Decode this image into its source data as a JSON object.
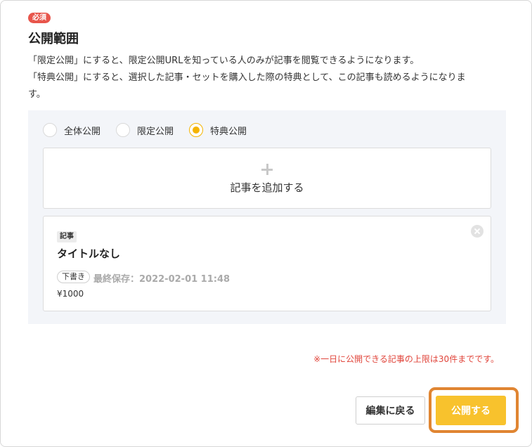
{
  "section": {
    "required_label": "必須",
    "title": "公開範囲",
    "description_line1": "「限定公開」にすると、限定公開URLを知っている人のみが記事を閲覧できるようになります。",
    "description_line2": "「特典公開」にすると、選択した記事・セットを購入した際の特典として、この記事も読めるようになりま",
    "description_line3": "す。"
  },
  "visibility_options": [
    {
      "label": "全体公開",
      "checked": false
    },
    {
      "label": "限定公開",
      "checked": false
    },
    {
      "label": "特典公開",
      "checked": true
    }
  ],
  "add_article": {
    "icon": "plus-icon",
    "label": "記事を追加する"
  },
  "selected_article": {
    "type_tag": "記事",
    "title": "タイトルなし",
    "status": "下書き",
    "last_saved": "最終保存：2022-02-01 11:48",
    "price": "¥1000",
    "remove_icon": "close-icon"
  },
  "limit_note": "※一日に公開できる記事の上限は30件までです。",
  "footer": {
    "back_label": "編集に戻る",
    "publish_label": "公開する"
  },
  "colors": {
    "accent": "#f8c22d",
    "highlight_border": "#e08532",
    "required_badge": "#e8554b",
    "warning_text": "#e0443a",
    "options_background": "#f3f5f9"
  }
}
